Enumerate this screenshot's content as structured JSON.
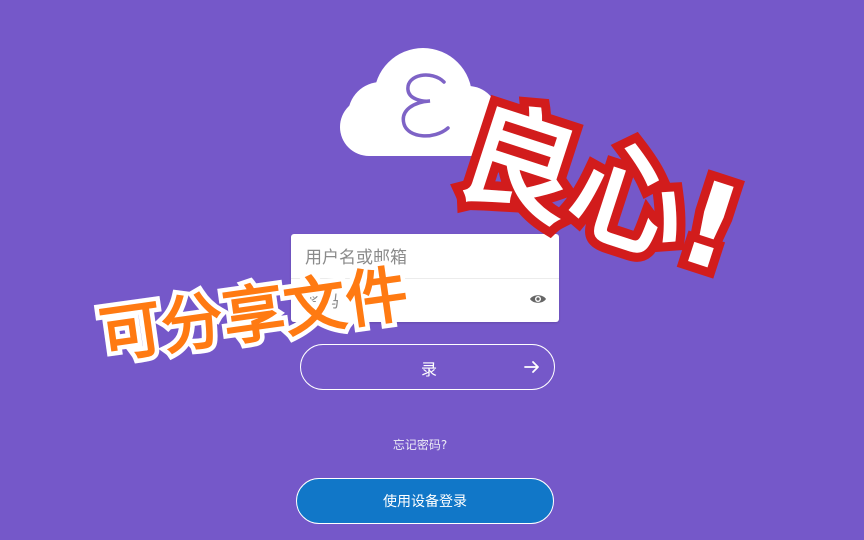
{
  "app": {
    "logo_letter": "E",
    "background_color": "#7558c9",
    "logo_letter_color": "#7e63c6"
  },
  "login_form": {
    "username_placeholder": "用户名或邮箱",
    "password_placeholder": "密码",
    "username_value": "",
    "password_value": "",
    "show_password_icon": "eye-icon",
    "login_label": "录",
    "login_arrow_icon": "arrow-right-icon"
  },
  "links": {
    "forgot_password": "忘记密码?"
  },
  "device_login": {
    "label": "使用设备登录",
    "color": "#1177c8"
  },
  "overlay": {
    "share_text": "可分享文件",
    "share_color": "#ff7a12",
    "conscience_text": "良心!",
    "conscience_outline_color": "#d21c1c"
  }
}
